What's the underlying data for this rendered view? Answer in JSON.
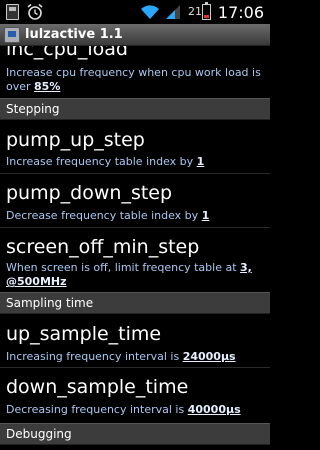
{
  "status_bar": {
    "battery_level": "21",
    "time": "17:06"
  },
  "title_bar": {
    "title": "lulzactive 1.1"
  },
  "preferences": [
    {
      "id": "inc_cpu_load",
      "title": "inc_cpu_load",
      "summary_prefix": "Increase cpu frequency when cpu work load is over ",
      "value": "85%"
    },
    {
      "id": "pump_up_step",
      "title": "pump_up_step",
      "summary_prefix": "Increase frequency table index by ",
      "value": "1"
    },
    {
      "id": "pump_down_step",
      "title": "pump_down_step",
      "summary_prefix": "Decrease frequency table index by ",
      "value": "1"
    },
    {
      "id": "screen_off_min_step",
      "title": "screen_off_min_step",
      "summary_prefix": "When screen is off, limit freqency table at ",
      "value": "3, @500MHz"
    },
    {
      "id": "up_sample_time",
      "title": "up_sample_time",
      "summary_prefix": "Increasing frequency interval is ",
      "value": "24000µs"
    },
    {
      "id": "down_sample_time",
      "title": "down_sample_time",
      "summary_prefix": "Decreasing frequency interval is ",
      "value": "40000µs"
    }
  ],
  "categories": {
    "stepping": "Stepping",
    "sampling_time": "Sampling time",
    "debugging": "Debugging"
  }
}
